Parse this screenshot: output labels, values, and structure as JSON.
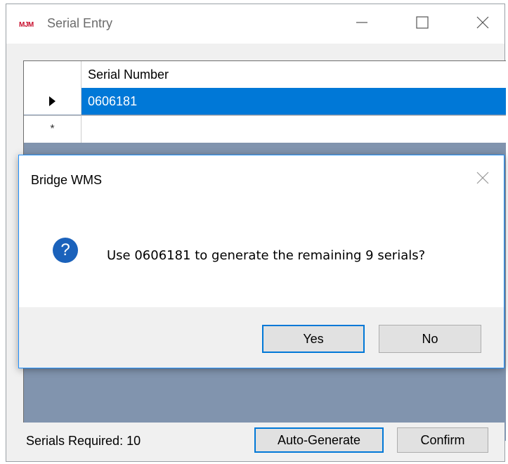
{
  "window": {
    "logo": "MJM",
    "title": "Serial Entry"
  },
  "grid": {
    "column_header": "Serial Number",
    "rows": [
      {
        "serial": "0606181",
        "selected": true
      },
      {
        "serial": "",
        "new_row": true
      }
    ]
  },
  "footer": {
    "serials_required": "Serials Required: 10",
    "auto_generate_label": "Auto-Generate",
    "confirm_label": "Confirm"
  },
  "dialog": {
    "title": "Bridge WMS",
    "icon": "question-icon",
    "message": "Use 0606181 to generate the remaining 9 serials?",
    "yes_label": "Yes",
    "no_label": "No"
  },
  "colors": {
    "selection": "#0078d7",
    "grid_background": "#8194ae",
    "question_icon": "#1b62bb"
  }
}
